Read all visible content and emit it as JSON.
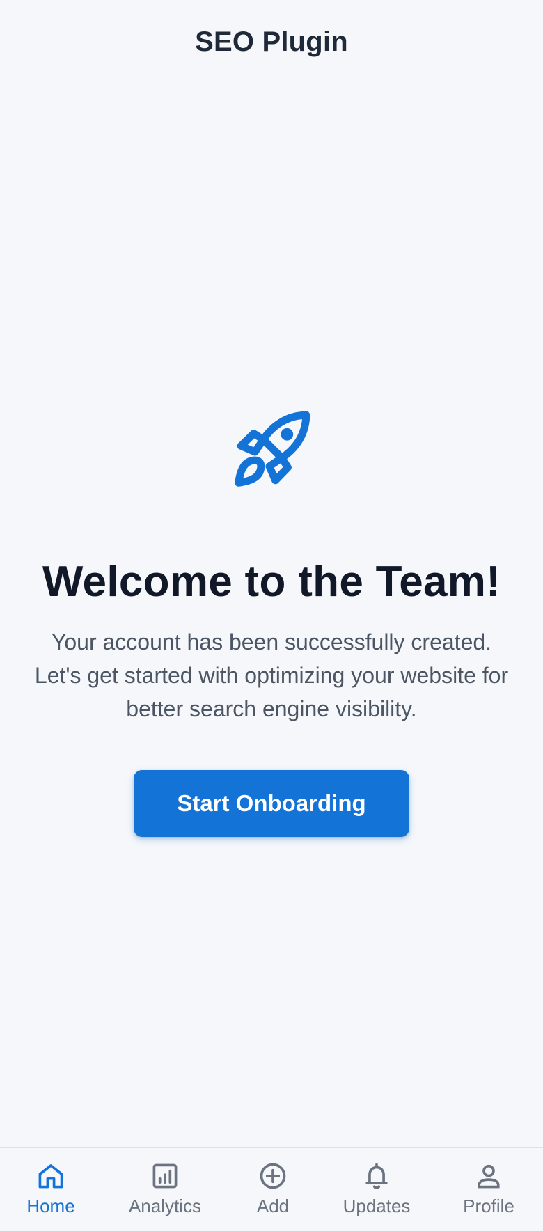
{
  "header": {
    "title": "SEO Plugin"
  },
  "welcome": {
    "icon": "rocket-icon",
    "title": "Welcome to the Team!",
    "message": "Your account has been successfully created. Let's get started with optimizing your website for better search engine visibility.",
    "button_label": "Start Onboarding"
  },
  "nav": {
    "active": "Home",
    "items": [
      {
        "label": "Home",
        "icon": "home-icon"
      },
      {
        "label": "Analytics",
        "icon": "analytics-icon"
      },
      {
        "label": "Add",
        "icon": "add-circle-icon"
      },
      {
        "label": "Updates",
        "icon": "bell-icon"
      },
      {
        "label": "Profile",
        "icon": "person-icon"
      }
    ]
  },
  "colors": {
    "accent": "#1473d6",
    "background": "#f5f7fa",
    "title_text": "#111827",
    "body_text": "#4b5563",
    "inactive_nav": "#6b7280"
  }
}
